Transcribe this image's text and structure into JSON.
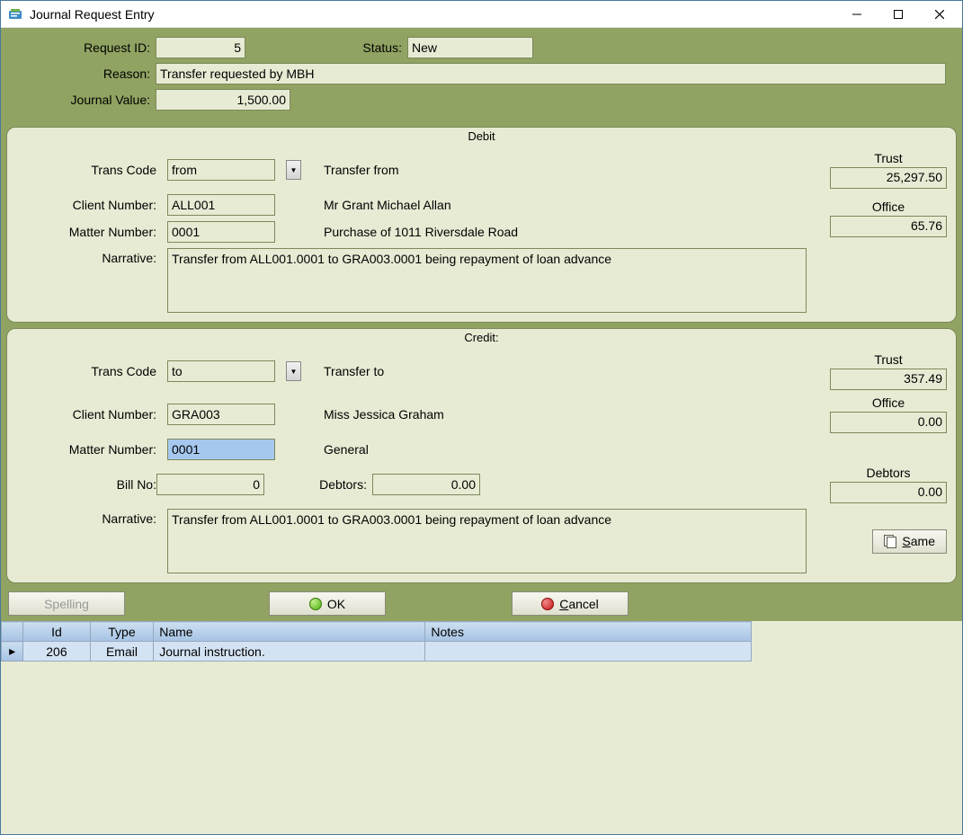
{
  "window": {
    "title": "Journal Request Entry"
  },
  "header": {
    "request_id_label": "Request ID:",
    "request_id": "5",
    "status_label": "Status:",
    "status": "New",
    "reason_label": "Reason:",
    "reason": "Transfer requested by MBH",
    "journal_value_label": "Journal Value:",
    "journal_value": "1,500.00"
  },
  "debit": {
    "title": "Debit",
    "trans_code_label": "Trans Code",
    "trans_code": "from",
    "trans_desc": "Transfer from",
    "client_number_label": "Client Number:",
    "client_number": "ALL001",
    "client_name": "Mr Grant Michael Allan",
    "matter_number_label": "Matter Number:",
    "matter_number": "0001",
    "matter_desc": "Purchase of 1011 Riversdale Road",
    "narrative_label": "Narrative:",
    "narrative": "Transfer from ALL001.0001 to GRA003.0001 being repayment of loan advance",
    "trust_label": "Trust",
    "trust_value": "25,297.50",
    "office_label": "Office",
    "office_value": "65.76"
  },
  "credit": {
    "title": "Credit:",
    "trans_code_label": "Trans Code",
    "trans_code": "to",
    "trans_desc": "Transfer to",
    "client_number_label": "Client Number:",
    "client_number": "GRA003",
    "client_name": "Miss Jessica Graham",
    "matter_number_label": "Matter Number:",
    "matter_number": "0001",
    "matter_desc": "General",
    "bill_no_label": "Bill No:",
    "bill_no": "0",
    "debtors_label": "Debtors:",
    "debtors_value": "0.00",
    "narrative_label": "Narrative:",
    "narrative": "Transfer from ALL001.0001 to GRA003.0001 being repayment of loan advance",
    "trust_label": "Trust",
    "trust_value": "357.49",
    "office_label": "Office",
    "office_value": "0.00",
    "debtors_caption": "Debtors",
    "debtors_box": "0.00",
    "same_label": "Same"
  },
  "buttons": {
    "spelling": "Spelling",
    "ok": "OK",
    "cancel": "Cancel"
  },
  "grid": {
    "headers": {
      "id": "Id",
      "type": "Type",
      "name": "Name",
      "notes": "Notes"
    },
    "row": {
      "id": "206",
      "type": "Email",
      "name": "Journal instruction.",
      "notes": ""
    }
  }
}
